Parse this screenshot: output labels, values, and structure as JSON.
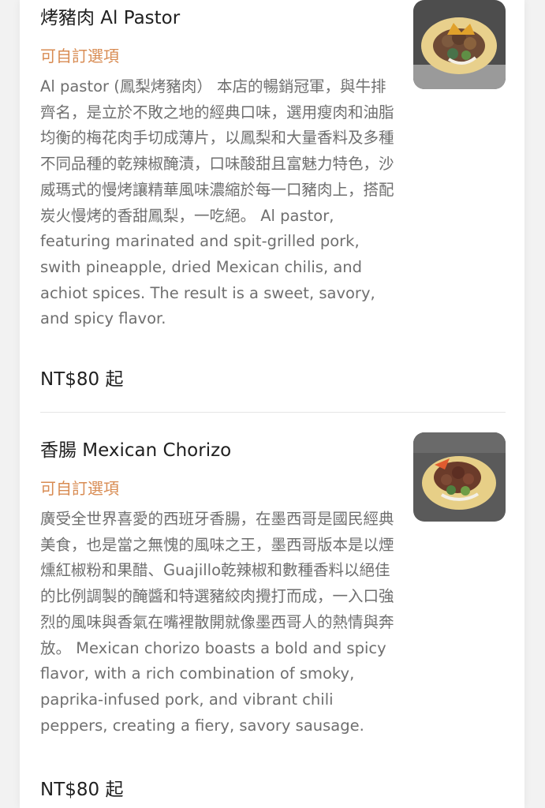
{
  "menu": {
    "items": [
      {
        "title": "烤豬肉 Al Pastor",
        "option_label": "可自訂選項",
        "description": "Al pastor (鳳梨烤豬肉） 本店的暢銷冠軍，與牛排齊名，是立於不敗之地的經典口味，選用瘦肉和油脂均衡的梅花肉手切成薄片，以鳳梨和大量香料及多種不同品種的乾辣椒醃漬，口味酸甜且富魅力特色，沙威瑪式的慢烤讓精華風味濃縮於每一口豬肉上，搭配炭火慢烤的香甜鳳梨，一吃絕。 Al pastor, featuring marinated and spit-grilled pork, swith pineapple, dried Mexican chilis, and achiot spices. The result is a sweet, savory, and spicy flavor.",
        "price": "NT$80 起",
        "image_icon": "taco-photo-icon"
      },
      {
        "title": "香腸 Mexican Chorizo",
        "option_label": "可自訂選項",
        "description": "廣受全世界喜愛的西班牙香腸，在墨西哥是國民經典美食，也是當之無愧的風味之王，墨西哥版本是以煙燻紅椒粉和果醋、Guajillo乾辣椒和數種香料以絕佳的比例調製的醃醬和特選豬絞肉攪打而成，一入口強烈的風味與香氣在嘴裡散開就像墨西哥人的熱情與奔放。 Mexican chorizo boasts a bold and spicy flavor, with a rich combination of smoky, paprika-infused pork, and vibrant chili peppers, creating a fiery, savory sausage.",
        "price": "NT$80 起",
        "image_icon": "taco-photo-icon"
      }
    ]
  },
  "colors": {
    "option_accent": "#d88b52",
    "title_text": "#1f1f1f",
    "body_text": "#6f6f6f"
  }
}
